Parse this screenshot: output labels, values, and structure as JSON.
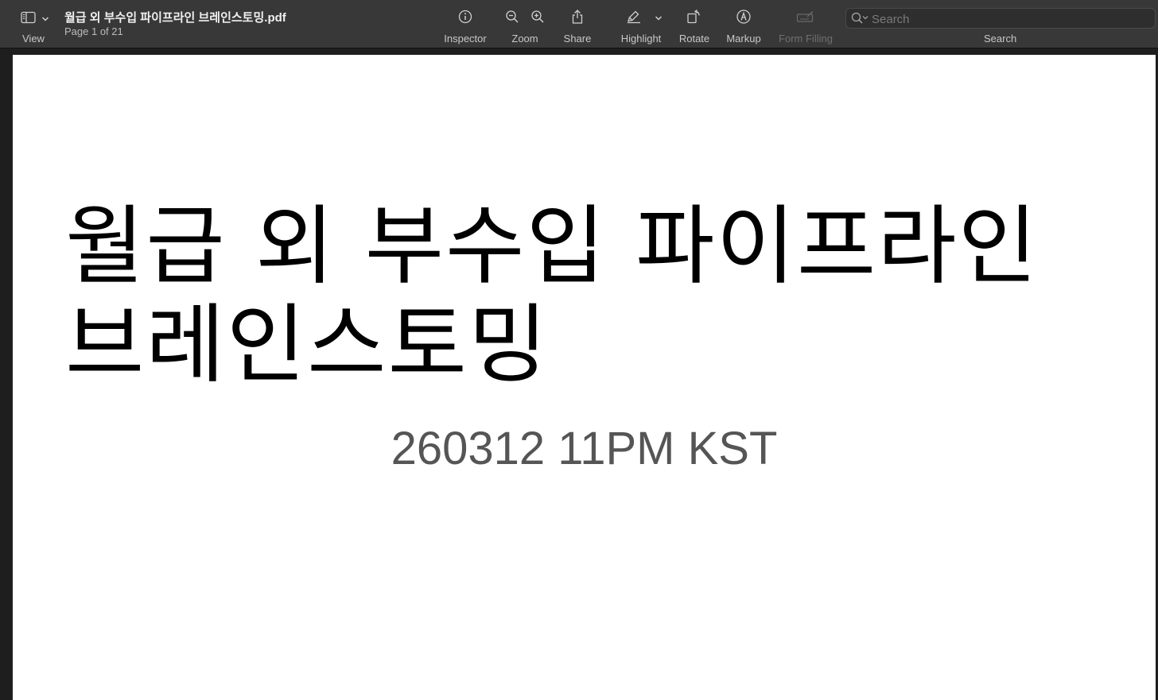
{
  "toolbar": {
    "view_label": "View",
    "document_title": "월급 외 부수입 파이프라인 브레인스토밍.pdf",
    "page_indicator": "Page 1 of 21",
    "tools": {
      "inspector": "Inspector",
      "zoom": "Zoom",
      "share": "Share",
      "highlight": "Highlight",
      "rotate": "Rotate",
      "markup": "Markup",
      "form_filling": "Form Filling"
    },
    "search": {
      "placeholder": "Search",
      "label": "Search"
    },
    "icons": [
      "sidebar-icon",
      "chevron-down-icon",
      "info-icon",
      "zoom-out-icon",
      "zoom-in-icon",
      "share-icon",
      "highlighter-icon",
      "rotate-icon",
      "markup-icon",
      "form-filling-icon",
      "search-icon"
    ]
  },
  "page": {
    "title_line1": "월급 외 부수입 파이프라인",
    "title_line2": "브레인스토밍",
    "date": "260312 11PM KST"
  },
  "colors": {
    "toolbar_bg": "#383838",
    "window_bg": "#1e1e1e",
    "page_bg": "#ffffff",
    "date_text": "#555555"
  }
}
